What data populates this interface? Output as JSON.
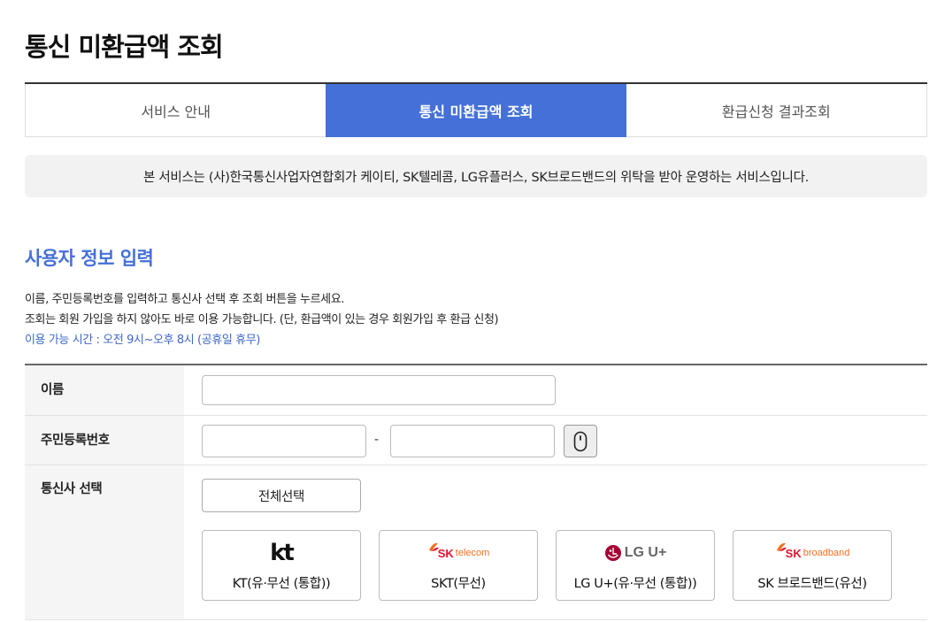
{
  "page": {
    "title": "통신 미환급액 조회"
  },
  "tabs": [
    {
      "label": "서비스 안내",
      "active": false
    },
    {
      "label": "통신 미환급액 조회",
      "active": true
    },
    {
      "label": "환급신청 결과조회",
      "active": false
    }
  ],
  "notice": {
    "text": "본 서비스는 (사)한국통신사업자연합회가 케이티, SK텔레콤, LG유플러스, SK브로드밴드의 위탁을 받아 운영하는 서비스입니다."
  },
  "section": {
    "title": "사용자 정보 입력",
    "desc_line1": "이름, 주민등록번호를 입력하고 통신사 선택 후 조회 버튼을 누르세요.",
    "desc_line2": "조회는 회원 가입을 하지 않아도 바로 이용 가능합니다. (단, 환급액이 있는 경우 회원가입 후 환급 신청)",
    "hours": "이용 가능 시간 : 오전 9시~오후 8시 (공휴일 휴무)"
  },
  "form": {
    "name_label": "이름",
    "name_value": "",
    "rrn_label": "주민등록번호",
    "rrn_first_value": "",
    "rrn_second_value": "",
    "rrn_dash": "-",
    "secure_keyboard_icon": "mouse-icon",
    "carrier_label": "통신사 선택",
    "select_all_label": "전체선택"
  },
  "carriers": [
    {
      "label": "KT(유·무선 (통합))",
      "logo_text": "kt"
    },
    {
      "label": "SKT(무선)",
      "logo_text_main": "SK",
      "logo_text_sub": "telecom"
    },
    {
      "label": "LG U+(유·무선 (통합))",
      "logo_text": "LG U+"
    },
    {
      "label": "SK 브로드밴드(유선)",
      "logo_text_main": "SK",
      "logo_text_sub": "broadband"
    }
  ],
  "colors": {
    "accent": "#4470d8",
    "notice_bg": "#f2f2f2",
    "label_bg": "#f5f5f5",
    "sk_red": "#e4142b",
    "sk_orange": "#f36f21",
    "lg_red": "#a50034"
  }
}
